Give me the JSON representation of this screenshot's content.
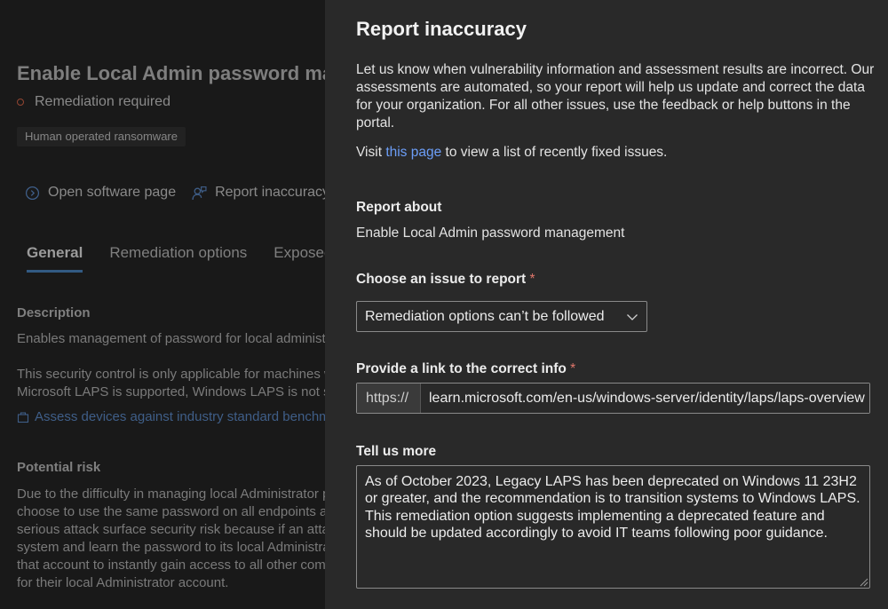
{
  "background": {
    "title": "Enable Local Admin password management",
    "status": "Remediation required",
    "tag": "Human operated ransomware",
    "actions": {
      "open_software": "Open software page",
      "report_inaccuracy": "Report inaccuracy"
    },
    "tabs": [
      "General",
      "Remediation options",
      "Exposed devices"
    ],
    "description_heading": "Description",
    "description_text": "Enables management of password for local administrator accounts",
    "note_lines": [
      "This security control is only applicable for machines with",
      "Microsoft LAPS is supported, Windows LAPS is not supported"
    ],
    "assess_link": "Assess devices against industry standard benchmarks",
    "risk_heading": "Potential risk",
    "risk_lines": [
      "Due to the difficulty in managing local Administrator passwords, many organizations",
      "choose to use the same password on all endpoints and servers. This poses a",
      "serious attack surface security risk because if an attacker compromises one",
      "system and learn the password to its local Administrator account, they can leverage",
      "that account to instantly gain access to all other computers that use the same password",
      "for their local Administrator account."
    ]
  },
  "panel": {
    "title": "Report inaccuracy",
    "intro": "Let us know when vulnerability information and assessment results are incorrect. Our assessments are automated, so your report will help us update and correct the data for your organization. For all other issues, use the feedback or help buttons in the portal.",
    "visit_prefix": "Visit ",
    "visit_link": "this page",
    "visit_suffix": " to view a list of recently fixed issues.",
    "report_about_label": "Report about",
    "report_about_value": "Enable Local Admin password management",
    "issue_label": "Choose an issue to report",
    "issue_selected": "Remediation options can’t be followed",
    "link_label": "Provide a link to the correct info",
    "link_prefix": "https://",
    "link_value": "learn.microsoft.com/en-us/windows-server/identity/laps/laps-overview",
    "more_label": "Tell us more",
    "more_text": "As of October 2023, Legacy LAPS has been deprecated on Windows 11 23H2 or greater, and the recommendation is to transition systems to Windows LAPS.\nThis remediation option suggests implementing a deprecated feature and should be updated accordingly to avoid IT teams following poor guidance.",
    "required_mark": "*"
  }
}
